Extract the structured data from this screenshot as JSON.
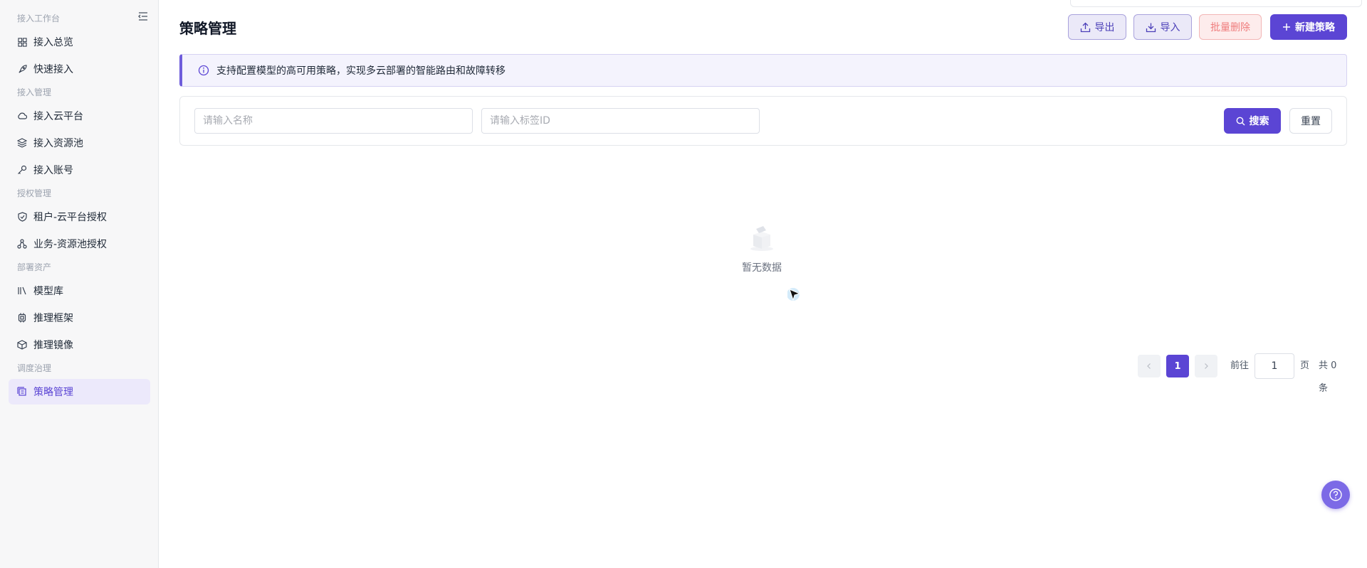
{
  "sidebar": {
    "groups": [
      {
        "label": "接入工作台"
      },
      {
        "label": "接入管理"
      },
      {
        "label": "授权管理"
      },
      {
        "label": "部署资产"
      },
      {
        "label": "调度治理"
      }
    ],
    "items": [
      {
        "label": "接入总览",
        "icon": "grid-icon"
      },
      {
        "label": "快速接入",
        "icon": "rocket-icon"
      },
      {
        "label": "接入云平台",
        "icon": "cloud-icon"
      },
      {
        "label": "接入资源池",
        "icon": "layers-icon"
      },
      {
        "label": "接入账号",
        "icon": "key-icon"
      },
      {
        "label": "租户-云平台授权",
        "icon": "shield-icon"
      },
      {
        "label": "业务-资源池授权",
        "icon": "share-nodes-icon"
      },
      {
        "label": "模型库",
        "icon": "library-icon"
      },
      {
        "label": "推理框架",
        "icon": "chip-icon"
      },
      {
        "label": "推理镜像",
        "icon": "box-icon"
      },
      {
        "label": "策略管理",
        "icon": "policy-icon",
        "active": true
      }
    ]
  },
  "header": {
    "title": "策略管理",
    "export_label": "导出",
    "import_label": "导入",
    "batch_delete_label": "批量删除",
    "create_label": "新建策略"
  },
  "alert": {
    "text": "支持配置模型的高可用策略，实现多云部署的智能路由和故障转移"
  },
  "filters": {
    "name_placeholder": "请输入名称",
    "tag_placeholder": "请输入标签ID",
    "search_label": "搜索",
    "reset_label": "重置"
  },
  "empty": {
    "text": "暂无数据"
  },
  "pagination": {
    "current_page": "1",
    "goto_label": "前往",
    "goto_value": "1",
    "page_suffix": "页",
    "total_text": "共 0 条"
  },
  "colors": {
    "accent": "#5b45d4",
    "accent_light": "#ece9fb",
    "danger": "#ef7c7c"
  }
}
